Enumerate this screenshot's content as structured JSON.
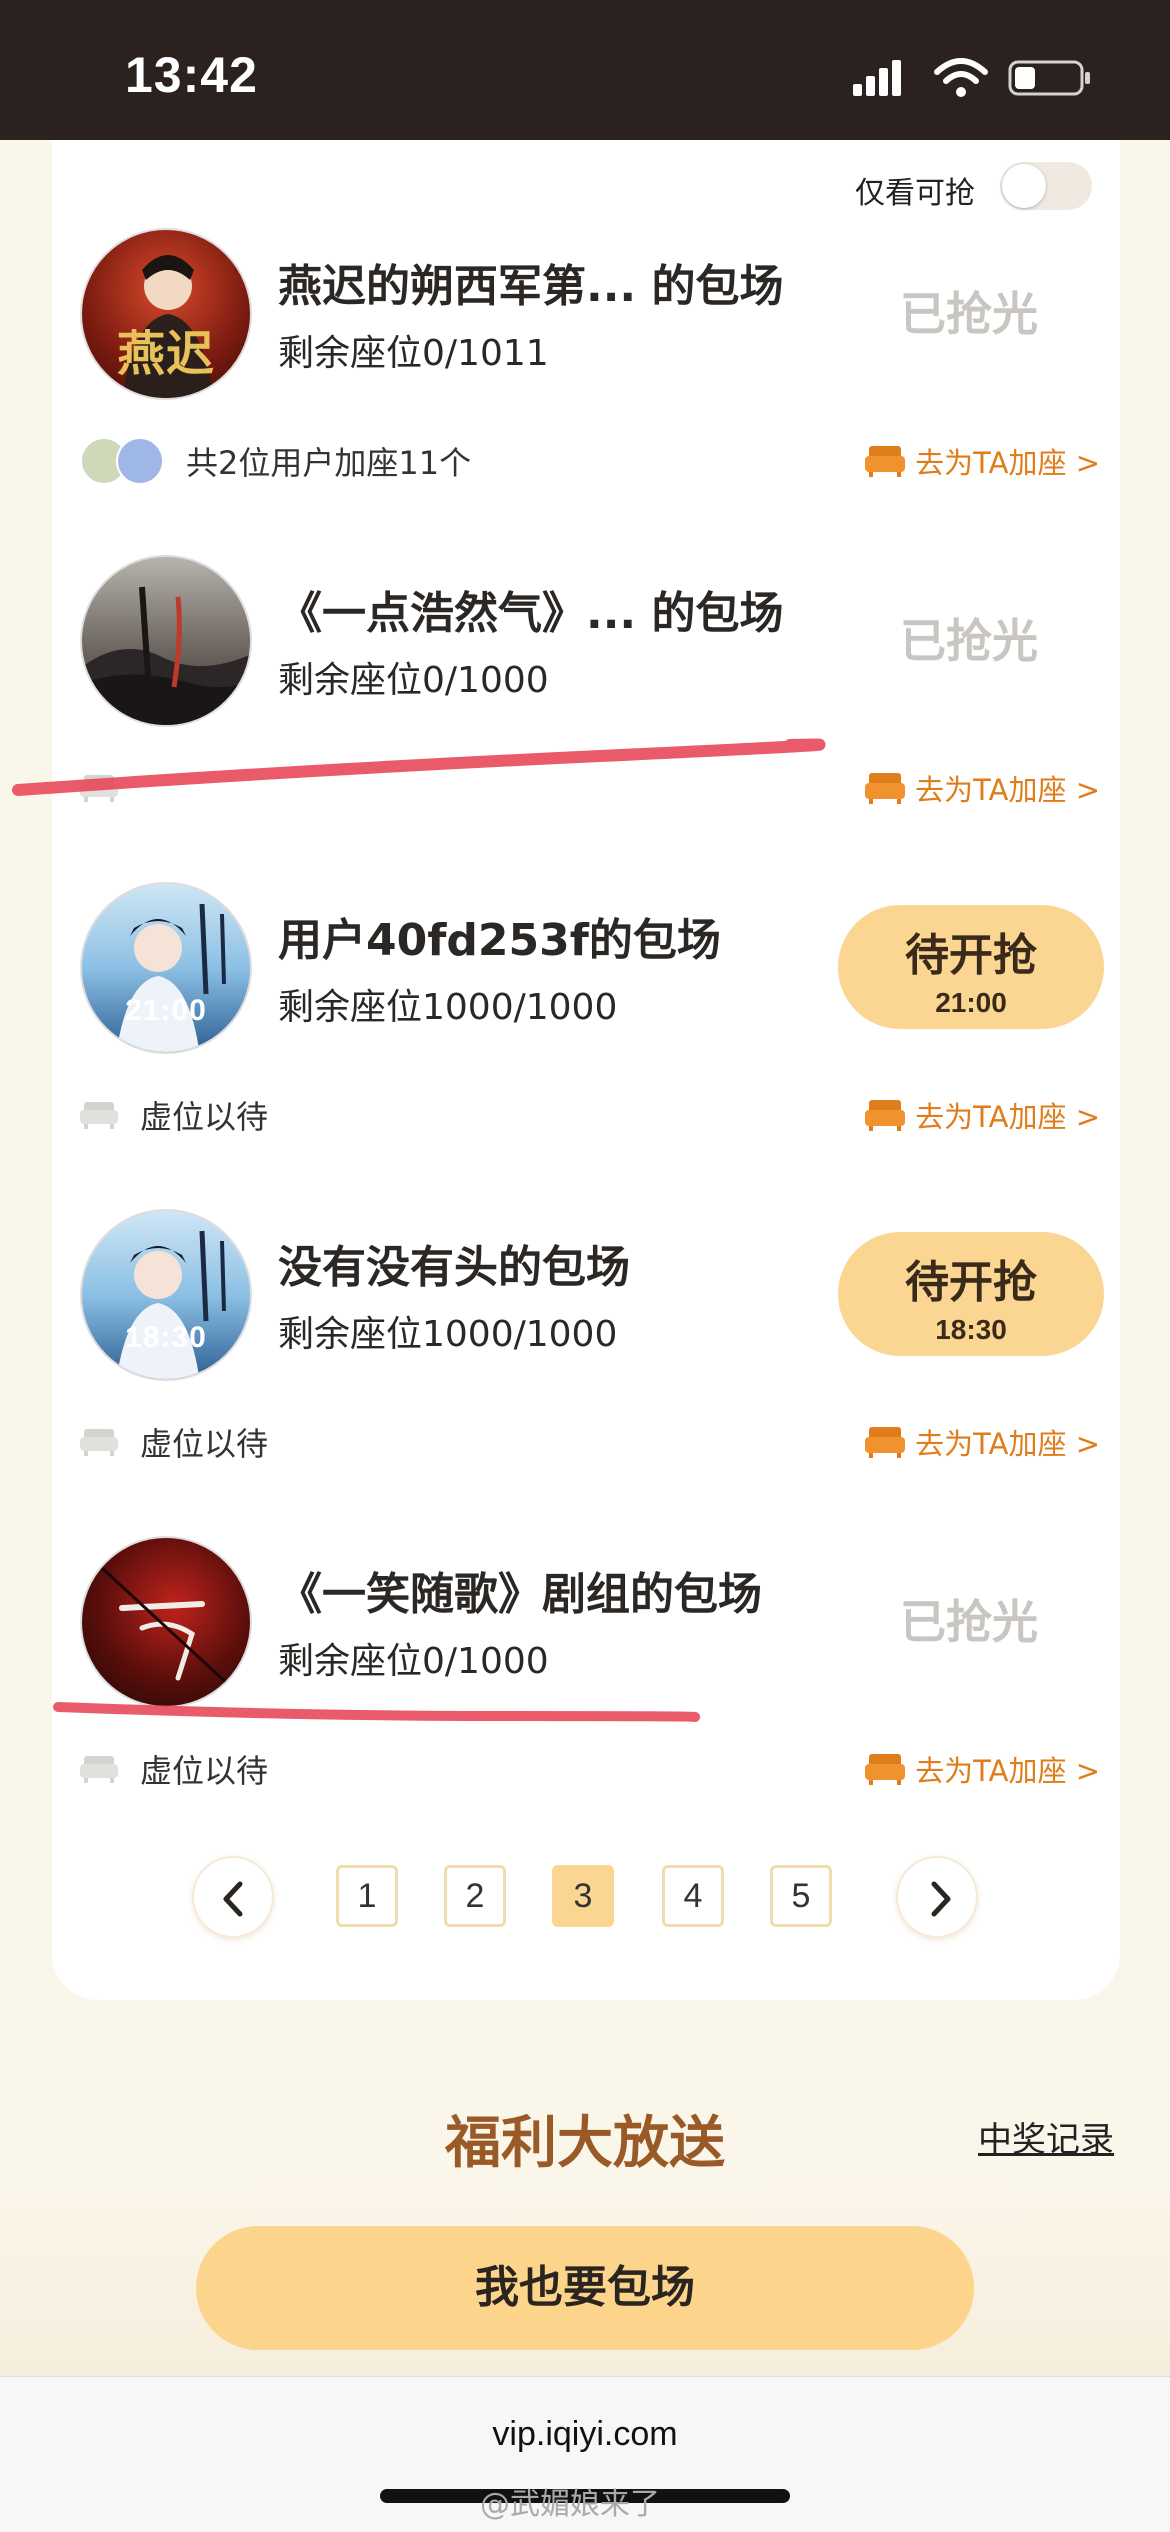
{
  "status_bar": {
    "time": "13:42"
  },
  "filter": {
    "label": "仅看可抢"
  },
  "rows": [
    {
      "title": "燕迟的朔西军第... 的包场",
      "seats": "剩余座位0/1011",
      "status": "已抢光",
      "avatar_text": "燕迟",
      "sub_text": "共2位用户加座11个",
      "action": "去为TA加座 >"
    },
    {
      "title": "《一点浩然气》... 的包场",
      "seats": "剩余座位0/1000",
      "status": "已抢光",
      "avatar_text": "",
      "sub_text": "",
      "action": "去为TA加座 >"
    },
    {
      "title": "用户40fd253f的包场",
      "seats": "剩余座位1000/1000",
      "status": "待开抢",
      "status_time": "21:00",
      "avatar_text": "21:00",
      "sub_text": "虚位以待",
      "action": "去为TA加座 >"
    },
    {
      "title": "没有没有头的包场",
      "seats": "剩余座位1000/1000",
      "status": "待开抢",
      "status_time": "18:30",
      "avatar_text": "18:30",
      "sub_text": "虚位以待",
      "action": "去为TA加座 >"
    },
    {
      "title": "《一笑随歌》剧组的包场",
      "seats": "剩余座位0/1000",
      "status": "已抢光",
      "avatar_text": "",
      "sub_text": "虚位以待",
      "action": "去为TA加座 >"
    }
  ],
  "pagination": {
    "pages": [
      "1",
      "2",
      "3",
      "4",
      "5"
    ],
    "current": "3"
  },
  "welfare": {
    "title": "福利大放送",
    "link": "中奖记录"
  },
  "main_button": {
    "label": "我也要包场"
  },
  "browser": {
    "url": "vip.iqiyi.com",
    "watermark": "@武媚娘来了"
  },
  "colors": {
    "accent": "#fbd592",
    "action": "#e07d1b",
    "dark": "#2b211e",
    "marker": "#e8495a"
  }
}
